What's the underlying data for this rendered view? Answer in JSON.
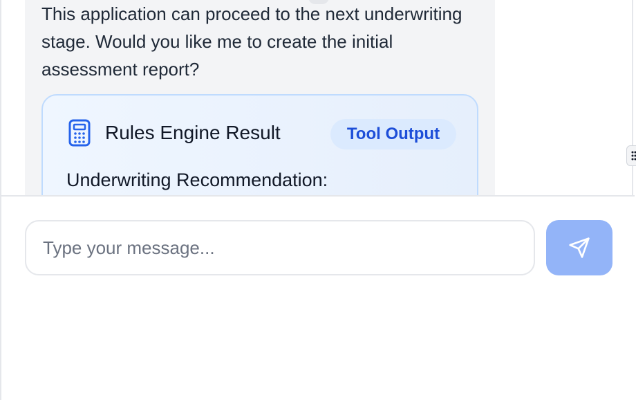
{
  "chat": {
    "assistant_message": "This application can proceed to the next underwriting stage. Would you like me to create the initial assessment report?",
    "tool_card": {
      "icon": "calculator-icon",
      "title": "Rules Engine Result",
      "badge": "Tool Output",
      "subtitle": "Underwriting Recommendation:"
    }
  },
  "composer": {
    "input_value": "",
    "placeholder": "Type your message...",
    "send_icon": "send-icon"
  },
  "colors": {
    "accent": "#1d4ed8",
    "send_button": "#93b4f8",
    "card_border": "#bfdbfe"
  }
}
